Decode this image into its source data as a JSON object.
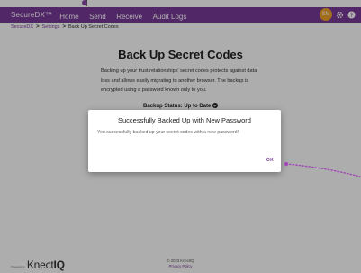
{
  "header": {
    "brand": "SecureDX™",
    "nav": [
      "Home",
      "Send",
      "Receive",
      "Audit Logs"
    ],
    "avatar_initials": "SM",
    "icons": [
      "settings-icon",
      "help-icon"
    ],
    "bar_color": "#7a3a9a",
    "avatar_color": "#f0a32a"
  },
  "breadcrumb": {
    "items": [
      "SecureDX",
      "Settings",
      "Back Up Secret Codes"
    ],
    "separator": ">"
  },
  "main": {
    "title": "Back Up Secret Codes",
    "description": "Backing up your trust relationships' secret codes protects against data loss and allows easily migrating to another browser. The backup is encrypted using a password known only to you.",
    "status": "Backup Status: Up to Date"
  },
  "dialog": {
    "title": "Successfully Backed Up with New Password",
    "body": "You successfully backed up your secret codes with a new password!",
    "ok_label": "OK"
  },
  "footer": {
    "powered_by": "Powered by",
    "logo_prefix": "Knect",
    "logo_suffix": "IQ",
    "copyright": "© 2023 KnectIQ",
    "privacy": "Privacy Policy"
  }
}
